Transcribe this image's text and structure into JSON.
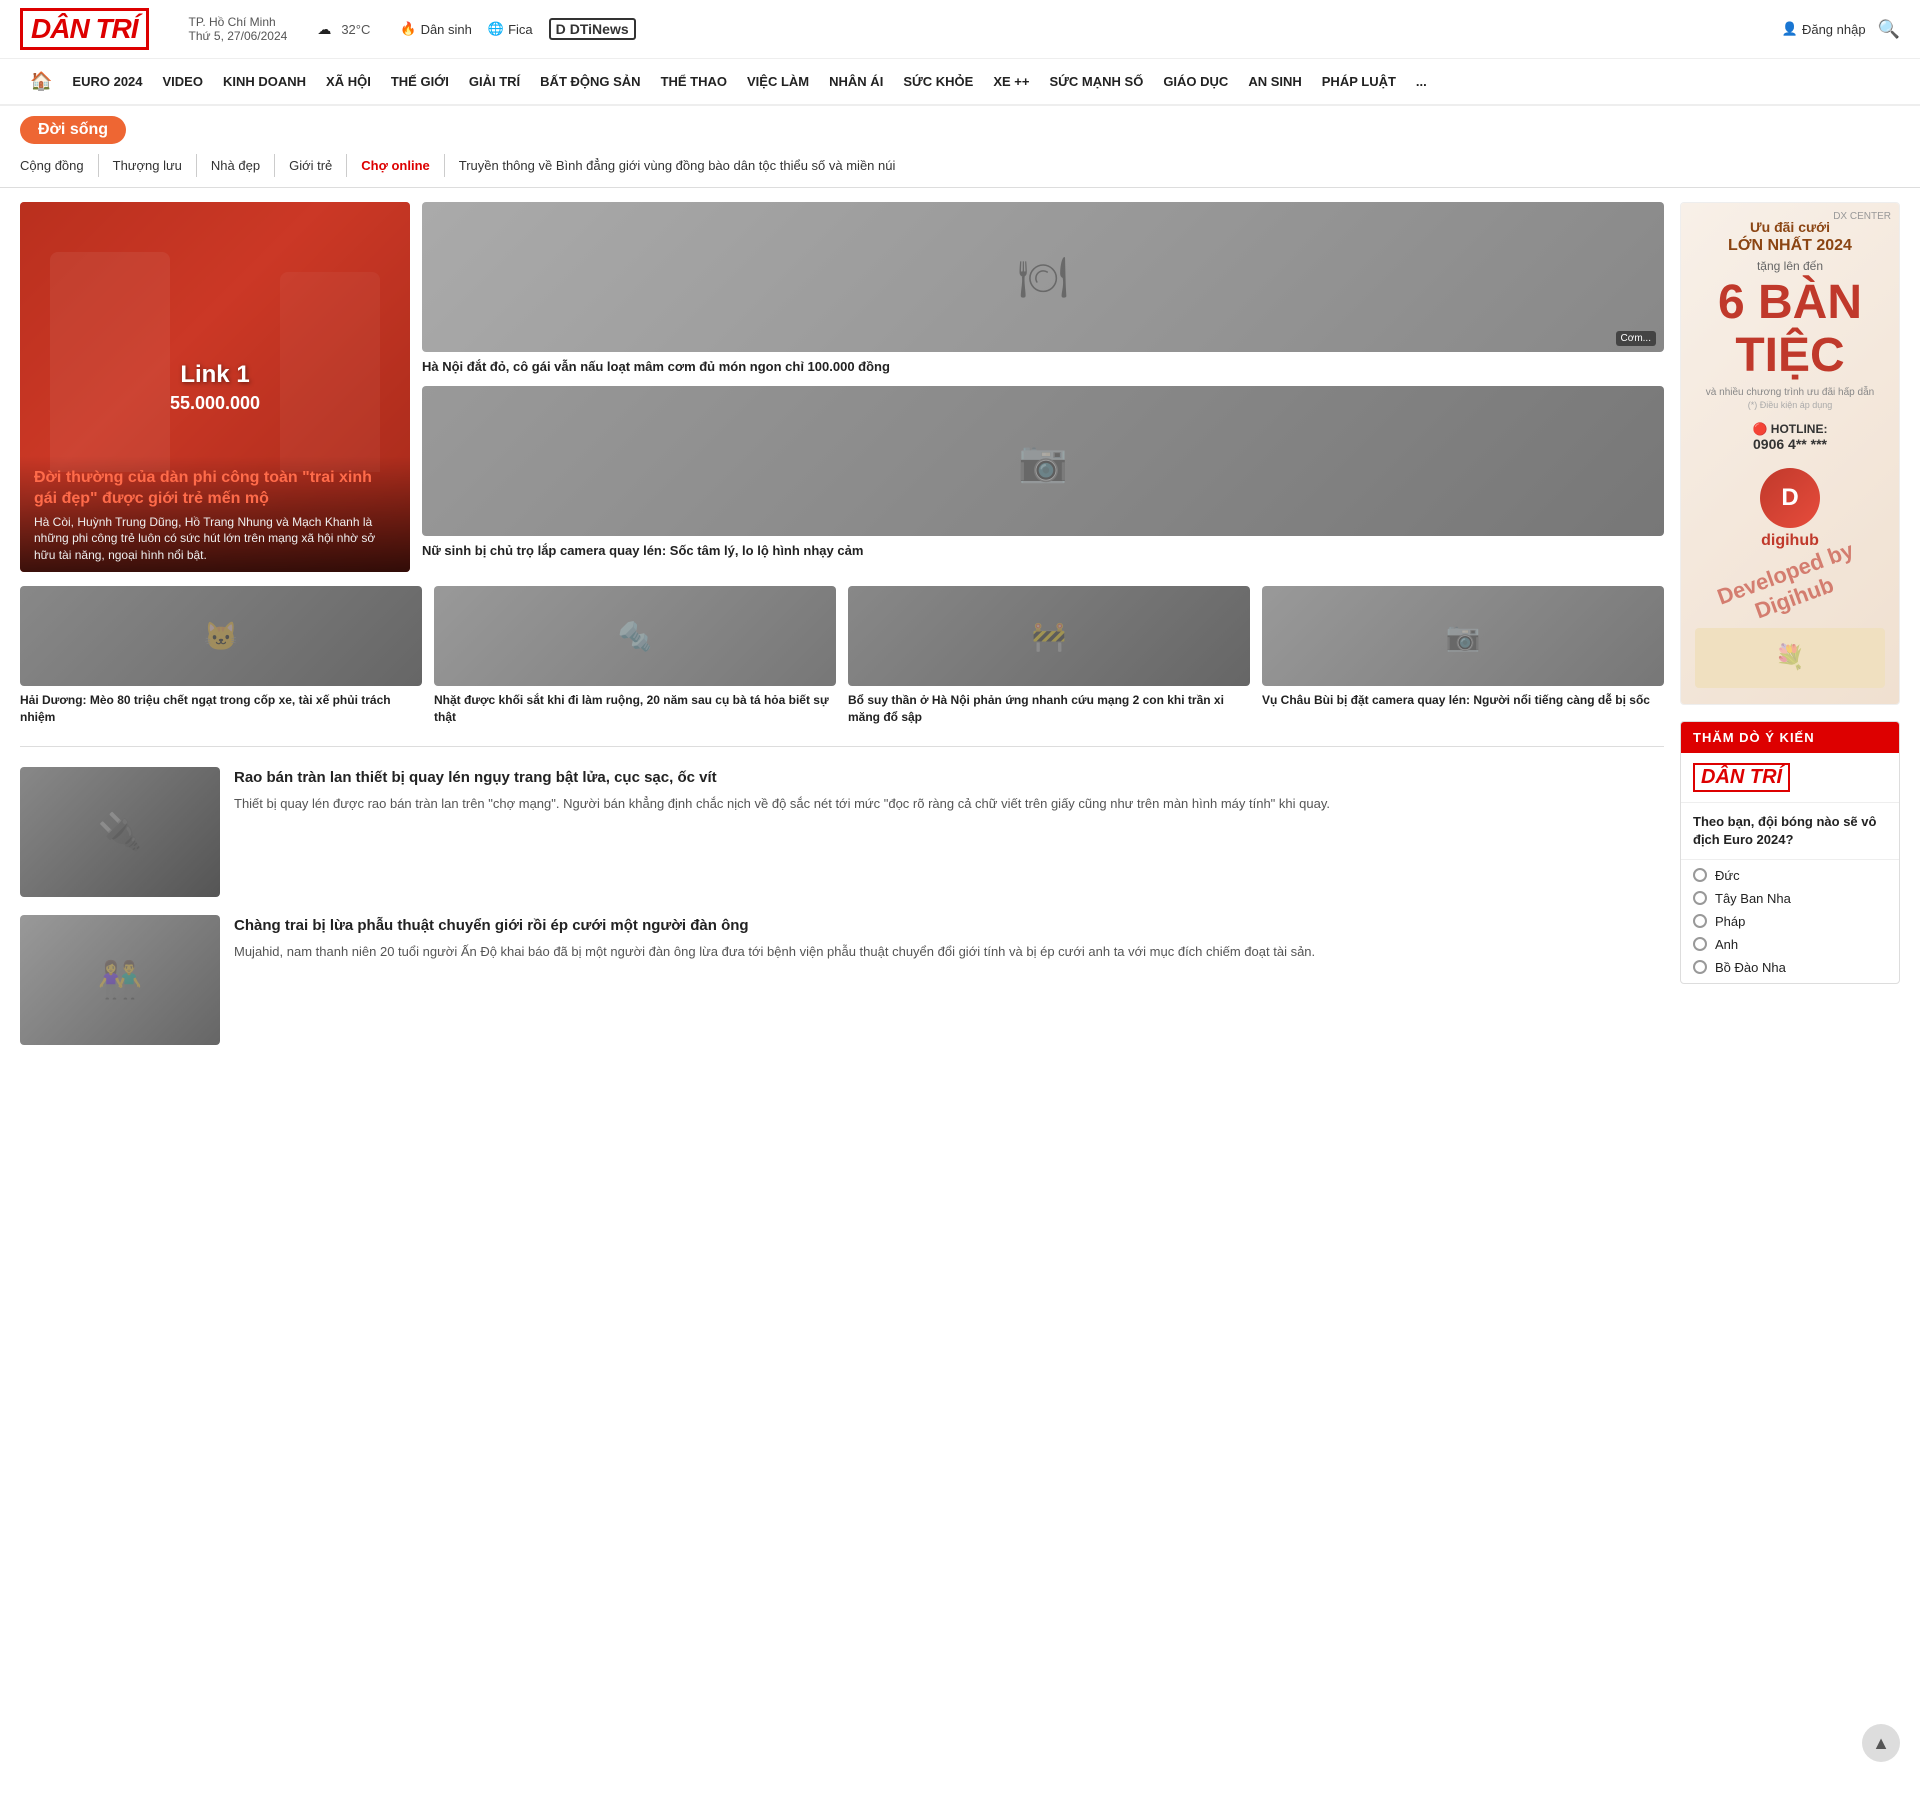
{
  "header": {
    "logo": "DÂN TRÍ",
    "location_city": "TP. Hồ Chí Minh",
    "location_date": "Thứ 5, 27/06/2024",
    "weather_icon": "☁",
    "weather_temp": "32°C",
    "icons": [
      {
        "icon": "🔥",
        "label": "Dân sinh"
      },
      {
        "icon": "🌐",
        "label": "Fica"
      },
      {
        "icon": "D",
        "label": "DTiNews"
      }
    ],
    "login_label": "Đăng nhập",
    "search_label": "🔍"
  },
  "main_nav": {
    "home_icon": "🏠",
    "items": [
      "EURO 2024",
      "VIDEO",
      "KINH DOANH",
      "XÃ HỘI",
      "THẾ GIỚI",
      "GIẢI TRÍ",
      "BẤT ĐỘNG SẢN",
      "THỂ THAO",
      "VIỆC LÀM",
      "NHÂN ÁI",
      "SỨC KHỎE",
      "XE ++",
      "SỨC MẠNH SỐ",
      "GIÁO DỤC",
      "AN SINH",
      "PHÁP LUẬT",
      "..."
    ]
  },
  "section": {
    "badge": "Đời sống"
  },
  "sub_nav": {
    "items": [
      "Cộng đồng",
      "Thượng lưu",
      "Nhà đẹp",
      "Giới trẻ",
      "Chợ online",
      "Truyền thông về Bình đẳng giới vùng đồng bào dân tộc thiểu số và miền núi"
    ],
    "active": "Chợ online"
  },
  "featured": {
    "main": {
      "overlay_title": "Link 1",
      "overlay_price": "55.000.000",
      "title": "Đời thường của dàn phi công toàn \"trai xinh gái đẹp\" được giới trẻ mến mộ",
      "desc": "Hà Còi, Huỳnh Trung Dũng, Hồ Trang Nhung và Mạch Khanh là những phi công trẻ luôn có sức hút lớn trên mạng xã hội nhờ sở hữu tài năng, ngoại hình nổi bật."
    },
    "side": [
      {
        "title": "Hà Nội đắt đỏ, cô gái vẫn nấu loạt mâm cơm đủ món ngon chỉ 100.000 đồng",
        "desc": ""
      },
      {
        "title": "Nữ sinh bị chủ trọ lắp camera quay lén: Sốc tâm lý, lo lộ hình nhạy cảm",
        "desc": ""
      }
    ]
  },
  "small_articles": [
    {
      "title": "Hải Dương: Mèo 80 triệu chết ngạt trong cốp xe, tài xế phủi trách nhiệm"
    },
    {
      "title": "Nhặt được khối sắt khi đi làm ruộng, 20 năm sau cụ bà tá hỏa biết sự thật"
    },
    {
      "title": "Bổ suy thần ở Hà Nội phản ứng nhanh cứu mạng 2 con khi trần xi măng đổ sập"
    },
    {
      "title": "Vụ Châu Bùi bị đặt camera quay lén: Người nổi tiếng càng dễ bị sốc"
    }
  ],
  "ad": {
    "top": "Ưu đãi cưới",
    "highlight": "LỚN NHẤT 2024",
    "desc1": "tặng lên đến",
    "year": "6 BÀN TIỆC",
    "desc2": "và nhiều chương trình ưu đãi hấp dẫn",
    "note": "(*) Điều kiện áp dụng",
    "hotline_label": "🔴 HOTLINE:",
    "hotline": "0906 4** ***",
    "dev": "Developed by Digihub"
  },
  "list_articles": [
    {
      "title": "Rao bán tràn lan thiết bị quay lén ngụy trang bật lửa, cục sạc, ốc vít",
      "desc": "Thiết bị quay lén được rao bán tràn lan trên \"chợ mạng\". Người bán khẳng định chắc nịch về độ sắc nét tới mức \"đọc rõ ràng cả chữ viết trên giấy cũng như trên màn hình máy tính\" khi quay."
    },
    {
      "title": "Chàng trai bị lừa phẫu thuật chuyển giới rồi ép cưới một người đàn ông",
      "desc": "Mujahid, nam thanh niên 20 tuổi người Ấn Độ khai báo đã bị một người đàn ông lừa đưa tới bệnh viện phẫu thuật chuyển đổi giới tính và bị ép cưới anh ta với mục đích chiếm đoạt tài sản."
    }
  ],
  "poll": {
    "header": "THĂM DÒ Ý KIẾN",
    "logo": "DÂN TRÍ",
    "question": "Theo bạn, đội bóng nào sẽ vô địch Euro 2024?",
    "options": [
      "Đức",
      "Tây Ban Nha",
      "Pháp",
      "Anh",
      "Bồ Đào Nha"
    ]
  },
  "scroll_top": "▲"
}
